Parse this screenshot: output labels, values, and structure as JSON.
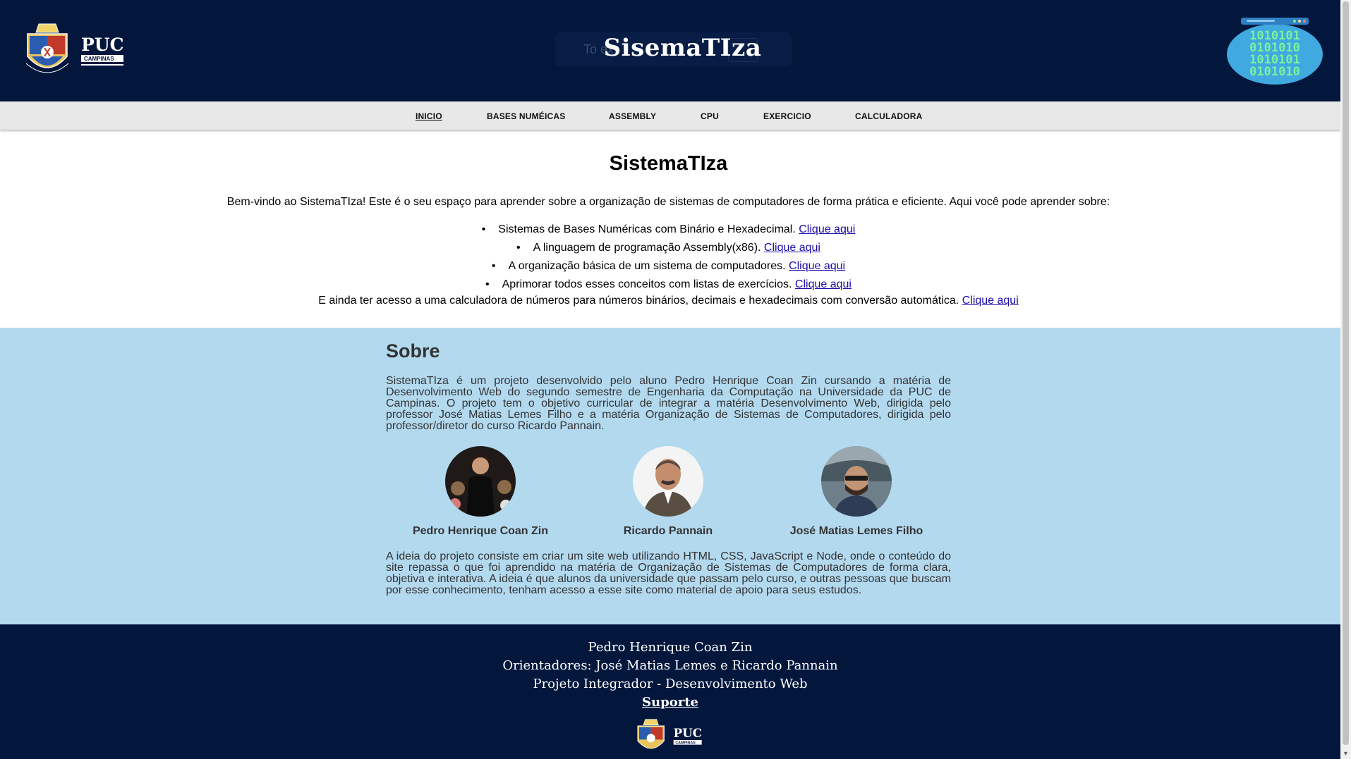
{
  "header": {
    "logo_text": "PUC",
    "logo_subtext": "CAMPINAS",
    "search_placeholder": "To ex",
    "site_title": "SisemaTIza",
    "binary_rows": [
      "1010101",
      "0101010",
      "1010101",
      "0101010"
    ]
  },
  "nav": {
    "items": [
      "INICIO",
      "BASES NUMÉICAS",
      "ASSEMBLY",
      "CPU",
      "EXERCICIO",
      "CALCULADORA"
    ],
    "active_index": 0
  },
  "intro": {
    "title": "SistemaTIza",
    "welcome": "Bem-vindo ao SistemaTIza! Este é o seu espaço para aprender sobre a organização de sistemas de computadores de forma prática e eficiente. Aqui você pode aprender sobre:",
    "topics": [
      {
        "text": "Sistemas de Bases Numéricas com Binário e Hexadecimal.",
        "link": "Clique aqui"
      },
      {
        "text": "A linguagem de programação Assembly(x86).",
        "link": "Clique aqui"
      },
      {
        "text": "A organização básica de um sistema de computadores.",
        "link": "Clique aqui"
      },
      {
        "text": "Aprimorar todos esses conceitos com listas de exercícios.",
        "link": "Clique aqui"
      }
    ],
    "extra_text": "E ainda ter acesso a uma calculadora de números para números binários, decimais e hexadecimais com conversão automática.",
    "extra_link": "Clique aqui"
  },
  "about": {
    "title": "Sobre",
    "paragraph1": "SistemaTIza é um projeto desenvolvido pelo aluno Pedro Henrique Coan Zin cursando a matéria de Desenvolvimento Web do segundo semestre de Engenharia da Computação na Universidade da PUC de Campinas. O projeto tem o objetivo curricular de integrar a matéria Desenvolvimento Web, dirigida pelo professor José Matias Lemes Filho e a matéria Organização de Sistemas de Computadores, dirigida pelo professor/diretor do curso Ricardo Pannain.",
    "people": [
      {
        "name": "Pedro Henrique Coan Zin"
      },
      {
        "name": "Ricardo Pannain"
      },
      {
        "name": "José Matias Lemes Filho"
      }
    ],
    "paragraph2": "A ideia do projeto consiste em criar um site web utilizando HTML, CSS, JavaScript e Node, onde o conteúdo do site repassa o que foi aprendido na matéria de Organização de Sistemas de Computadores de forma clara, objetiva e interativa. A ideia é que alunos da universidade que passam pelo curso, e outras pessoas que buscam por esse conhecimento, tenham acesso a esse site como material de apoio para seus estudos."
  },
  "footer": {
    "author": "Pedro Henrique Coan Zin",
    "advisors": "Orientadores: José Matias Lemes e Ricardo Pannain",
    "project": "Projeto Integrador - Desenvolvimento Web",
    "support": "Suporte"
  },
  "colors": {
    "header_bg": "#03173d",
    "nav_bg": "#e8e8e8",
    "about_bg": "#b3d9ef",
    "link": "#1a0dab",
    "binary_badge": "#3fa9e0",
    "binary_text": "#7cf29a"
  }
}
